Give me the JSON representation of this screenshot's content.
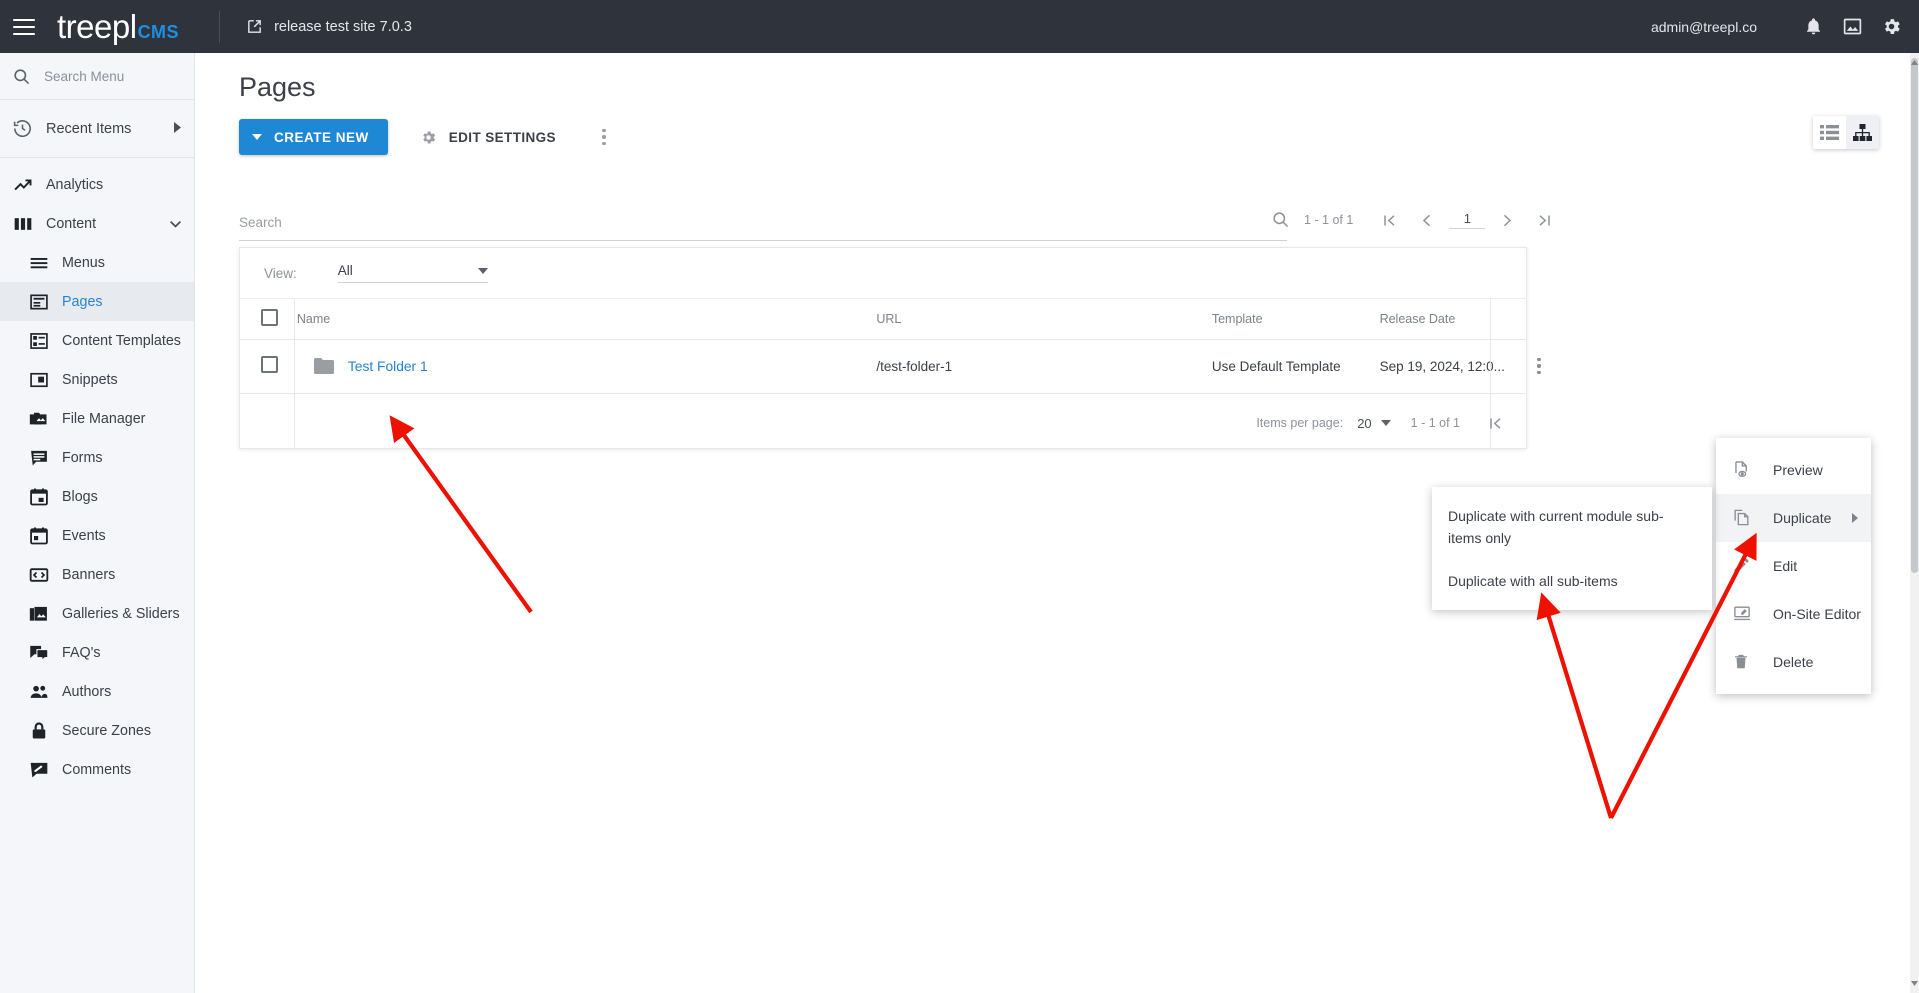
{
  "topbar": {
    "brand_name": "treepl",
    "brand_suffix": "CMS",
    "site_name": "release test site 7.0.3",
    "user_email": "admin@treepl.co",
    "menu_icon": "hamburger-icon",
    "site_icon": "external-link-icon",
    "icons": [
      {
        "name": "notifications-bell-icon"
      },
      {
        "name": "image-icon"
      },
      {
        "name": "settings-gear-icon"
      }
    ]
  },
  "sidebar": {
    "search_placeholder": "Search Menu",
    "recent": {
      "label": "Recent Items",
      "icon": "history-icon"
    },
    "items": [
      {
        "label": "Analytics",
        "icon": "trending-up-icon",
        "level": "top",
        "active": false,
        "expandable": false
      },
      {
        "label": "Content",
        "icon": "columns-icon",
        "level": "top",
        "active": false,
        "expandable": true
      },
      {
        "label": "Menus",
        "icon": "menu-list-icon",
        "level": "sub",
        "active": false,
        "expandable": false
      },
      {
        "label": "Pages",
        "icon": "page-icon",
        "level": "sub",
        "active": true,
        "expandable": false
      },
      {
        "label": "Content Templates",
        "icon": "content-template-icon",
        "level": "sub",
        "active": false,
        "expandable": false
      },
      {
        "label": "Snippets",
        "icon": "snippet-icon",
        "level": "sub",
        "active": false,
        "expandable": false
      },
      {
        "label": "File Manager",
        "icon": "file-manager-icon",
        "level": "sub",
        "active": false,
        "expandable": false
      },
      {
        "label": "Forms",
        "icon": "forms-icon",
        "level": "sub",
        "active": false,
        "expandable": false
      },
      {
        "label": "Blogs",
        "icon": "calendar-blog-icon",
        "level": "sub",
        "active": false,
        "expandable": false
      },
      {
        "label": "Events",
        "icon": "calendar-event-icon",
        "level": "sub",
        "active": false,
        "expandable": false
      },
      {
        "label": "Banners",
        "icon": "banner-icon",
        "level": "sub",
        "active": false,
        "expandable": false
      },
      {
        "label": "Galleries & Sliders",
        "icon": "gallery-icon",
        "level": "sub",
        "active": false,
        "expandable": false
      },
      {
        "label": "FAQ's",
        "icon": "faq-chat-icon",
        "level": "sub",
        "active": false,
        "expandable": false
      },
      {
        "label": "Authors",
        "icon": "authors-people-icon",
        "level": "sub",
        "active": false,
        "expandable": false
      },
      {
        "label": "Secure Zones",
        "icon": "lock-icon",
        "level": "sub",
        "active": false,
        "expandable": false
      },
      {
        "label": "Comments",
        "icon": "comments-icon",
        "level": "sub",
        "active": false,
        "expandable": false
      }
    ]
  },
  "main": {
    "page_title": "Pages",
    "create_button": "CREATE NEW",
    "edit_settings_button": "EDIT SETTINGS",
    "more_actions_icon": "kebab-menu-icon",
    "view_toggle": [
      {
        "name": "list-view-icon",
        "selected": false
      },
      {
        "name": "tree-view-icon",
        "selected": true
      }
    ],
    "search_placeholder": "Search",
    "search_icon": "search-icon",
    "pager_top": {
      "count": "1 - 1 of 1",
      "first_icon": "first-page-icon",
      "prev_icon": "prev-page-icon",
      "page": "1",
      "next_icon": "next-page-icon",
      "last_icon": "last-page-icon"
    },
    "view_filter": {
      "label": "View:",
      "value": "All"
    },
    "table": {
      "columns": [
        "Name",
        "URL",
        "Template",
        "Release Date"
      ],
      "rows": [
        {
          "name": "Test Folder 1",
          "url": "/test-folder-1",
          "template": "Use Default Template",
          "release_date": "Sep 19, 2024, 12:0...",
          "icon": "folder-icon"
        }
      ]
    },
    "footer_pager": {
      "items_per_page_label": "Items per page:",
      "items_per_page_value": "20",
      "count": "1 - 1 of 1",
      "first_icon": "first-page-icon"
    }
  },
  "context_menu": {
    "items": [
      {
        "label": "Preview",
        "icon": "preview-icon",
        "highlight": false,
        "has_submenu": false
      },
      {
        "label": "Duplicate",
        "icon": "duplicate-icon",
        "highlight": true,
        "has_submenu": true
      },
      {
        "label": "Edit",
        "icon": "pencil-edit-icon",
        "highlight": false,
        "has_submenu": false
      },
      {
        "label": "On-Site Editor",
        "icon": "on-site-editor-icon",
        "highlight": false,
        "has_submenu": false
      },
      {
        "label": "Delete",
        "icon": "trash-delete-icon",
        "highlight": false,
        "has_submenu": false
      }
    ]
  },
  "submenu": {
    "items": [
      {
        "label": "Duplicate with current module sub-items only"
      },
      {
        "label": "Duplicate with all sub-items"
      }
    ]
  },
  "colors": {
    "topbar_bg": "#2f343c",
    "brand_accent": "#1e8fe1",
    "primary_button": "#1e88d4",
    "link": "#2683d4",
    "sidebar_bg": "#f4f6f9",
    "annotation_red": "#ee1100"
  }
}
